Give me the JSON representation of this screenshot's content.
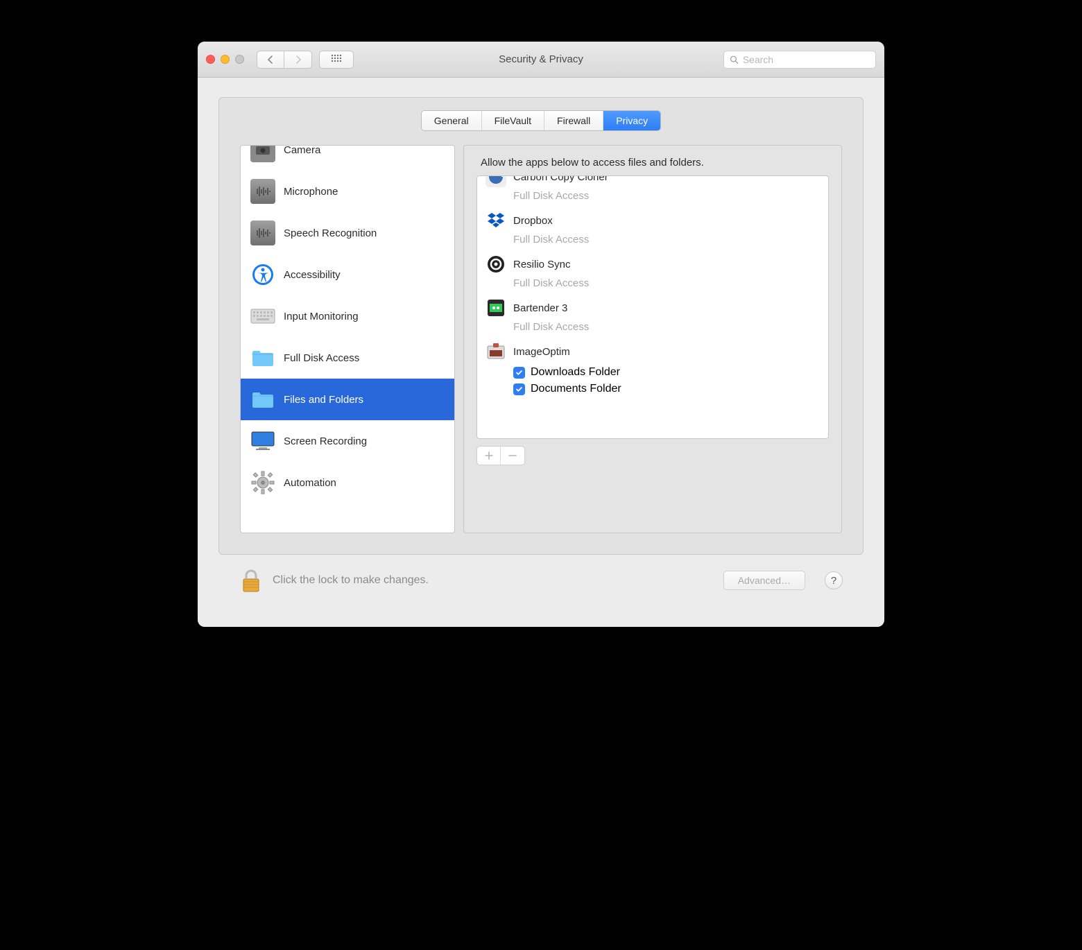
{
  "window": {
    "title": "Security & Privacy"
  },
  "search": {
    "placeholder": "Search"
  },
  "tabs": [
    {
      "label": "General"
    },
    {
      "label": "FileVault"
    },
    {
      "label": "Firewall"
    },
    {
      "label": "Privacy"
    }
  ],
  "sidebar": {
    "items": [
      {
        "label": "Camera"
      },
      {
        "label": "Microphone"
      },
      {
        "label": "Speech Recognition"
      },
      {
        "label": "Accessibility"
      },
      {
        "label": "Input Monitoring"
      },
      {
        "label": "Full Disk Access"
      },
      {
        "label": "Files and Folders"
      },
      {
        "label": "Screen Recording"
      },
      {
        "label": "Automation"
      }
    ]
  },
  "content": {
    "heading": "Allow the apps below to access files and folders.",
    "apps": [
      {
        "name": "Carbon Copy Cloner",
        "sub": "Full Disk Access"
      },
      {
        "name": "Dropbox",
        "sub": "Full Disk Access"
      },
      {
        "name": "Resilio Sync",
        "sub": "Full Disk Access"
      },
      {
        "name": "Bartender 3",
        "sub": "Full Disk Access"
      },
      {
        "name": "ImageOptim",
        "perms": [
          "Downloads Folder",
          "Documents Folder"
        ]
      }
    ]
  },
  "footer": {
    "lock_text": "Click the lock to make changes.",
    "advanced": "Advanced…",
    "help": "?"
  }
}
